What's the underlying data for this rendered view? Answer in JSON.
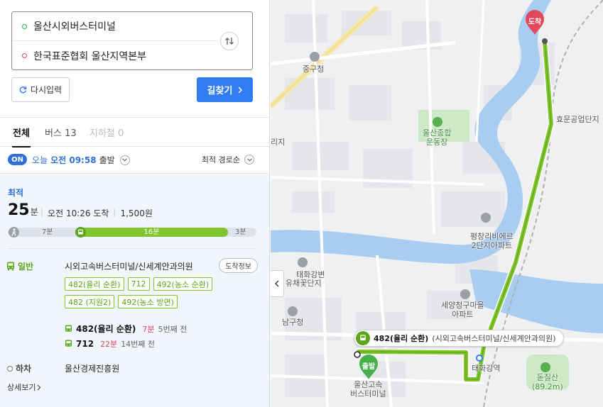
{
  "search": {
    "origin": "울산시외버스터미널",
    "destination": "한국표준협회 울산지역본부",
    "reset_label": "다시입력",
    "search_label": "길찾기"
  },
  "tabs": [
    {
      "label": "전체",
      "count": ""
    },
    {
      "label": "버스",
      "count": "13"
    },
    {
      "label": "지하철",
      "count": "0"
    }
  ],
  "departure": {
    "toggle": "ON",
    "day": "오늘",
    "time": "오전 09:58",
    "suffix": "출발",
    "sort": "최적 경로순"
  },
  "result": {
    "badge": "최적",
    "duration_value": "25",
    "duration_unit": "분",
    "arrival": "오전 10:26 도착",
    "fare": "1,500원",
    "progress": {
      "walk1": "7분",
      "bus": "16분",
      "walk2": "3분"
    },
    "segment": {
      "type": "일반",
      "from": "시외고속버스터미널/신세계안과의원",
      "info_button": "도착정보",
      "lines": [
        "482(율리 순환)",
        "712",
        "492(농소 순환)",
        "482 (지원2)",
        "492(농소 방면)"
      ],
      "arrivals": [
        {
          "line": "482(율리 순환)",
          "mins": "7분",
          "stops": "5번째 전"
        },
        {
          "line": "712",
          "mins": "22분",
          "stops": "14번째 전"
        }
      ]
    },
    "alight": {
      "label": "하차",
      "place": "울산경제진흥원"
    },
    "detail_link": "상세보기"
  },
  "map": {
    "labels": {
      "junggu": "중구청",
      "stadium": "울산종합\n운동장",
      "hyomun": "효문공업단지",
      "pyeongchang": "평창리비에르\n2단지아파트",
      "taehwa_prefix": "태화강변",
      "taehwa_suffix": "유채꽃단지",
      "seyang": "세양청구마을\n아파트",
      "namgu": "남구청",
      "taehwa_station": "태화강역",
      "terminal": "울산고속\n버스터미널",
      "dolgilsan": "돋질산\n(89.2m)",
      "edge": "리지"
    },
    "start_pin": "출발",
    "end_pin": "도착",
    "callout": {
      "line": "482(율리 순환)",
      "stop": "(시외고속버스터미널/신세계안과의원)"
    },
    "colors": {
      "route": "#7fc52b",
      "river": "#a9cdf0",
      "park": "#cde8c6",
      "accent": "#2f7df0",
      "end_pin": "#e2475c",
      "start_pin": "#46b04a"
    }
  }
}
